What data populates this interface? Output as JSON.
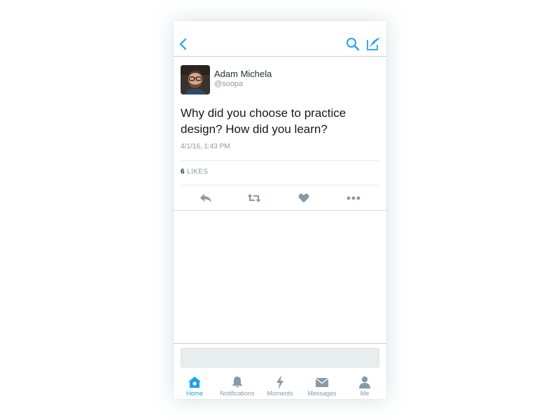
{
  "colors": {
    "accent": "#1da1f2",
    "icon_gray": "#8899a6",
    "text_dark": "#14171a",
    "divider": "#e6ecf0"
  },
  "navbar": {
    "back_icon": "chevron-left-icon",
    "search_icon": "search-icon",
    "compose_icon": "compose-tweet-icon"
  },
  "tweet": {
    "author_name": "Adam Michela",
    "author_handle": "@soopa",
    "text": "Why did you choose to practice design? How did you learn?",
    "timestamp": "4/1/16, 1:43 PM",
    "likes_count": "6",
    "likes_label": "LIKES",
    "actions": [
      "reply-icon",
      "retweet-icon",
      "heart-icon",
      "more-icon"
    ]
  },
  "tabbar": {
    "tabs": [
      {
        "label": "Home",
        "icon": "home-icon",
        "active": true
      },
      {
        "label": "Notifications",
        "icon": "bell-icon",
        "active": false
      },
      {
        "label": "Moments",
        "icon": "lightning-icon",
        "active": false
      },
      {
        "label": "Messages",
        "icon": "envelope-icon",
        "active": false
      },
      {
        "label": "Me",
        "icon": "person-icon",
        "active": false
      }
    ]
  }
}
